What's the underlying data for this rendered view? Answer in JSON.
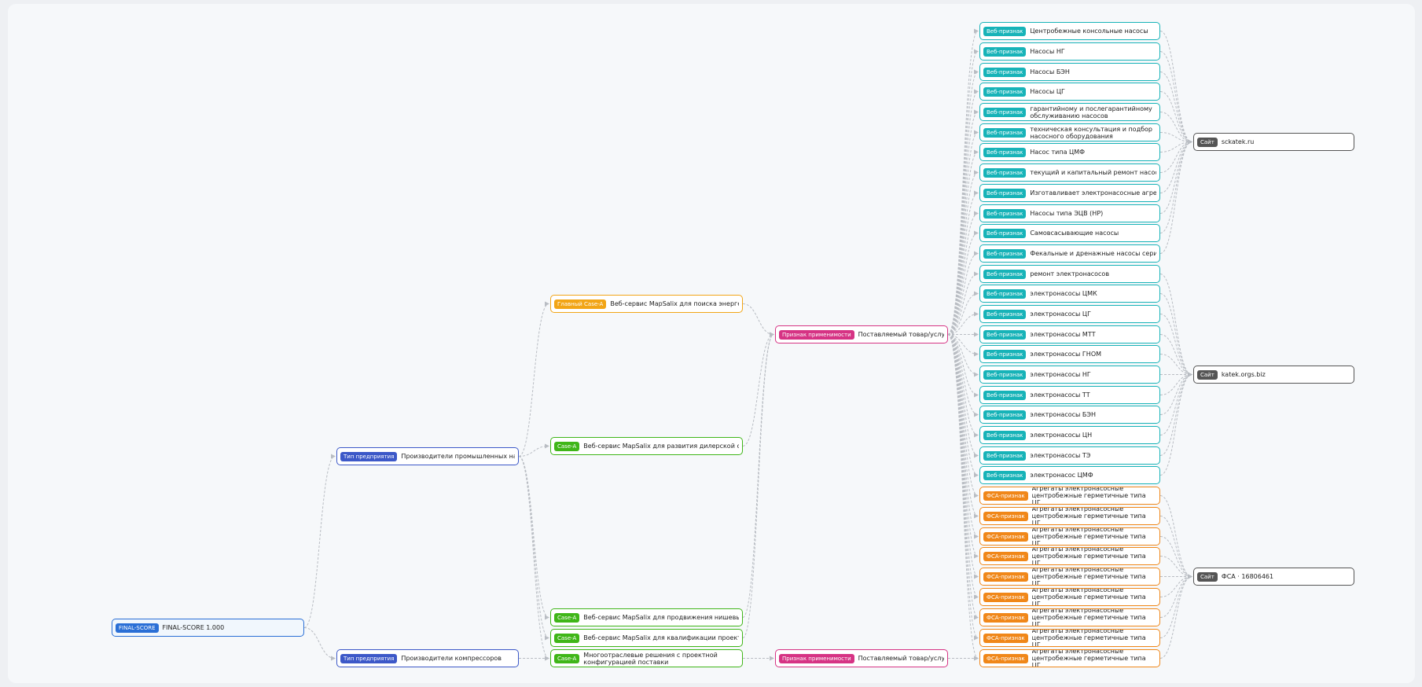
{
  "colors": {
    "final": "#2a6fd6",
    "type": "#3c58c8",
    "main_case": "#f2a516",
    "case": "#3fb618",
    "applicability": "#d63384",
    "web": "#17b3b8",
    "fsa": "#f08719",
    "site": "#555555",
    "edge": "#b9bdc3"
  },
  "nodes": {
    "final": {
      "tag": "FINAL-SCORE",
      "label": "FINAL-SCORE 1.000"
    },
    "type_pumps": {
      "tag": "Тип предприятия",
      "label": "Производители промышленных насосов"
    },
    "type_compressors": {
      "tag": "Тип предприятия",
      "label": "Производители компрессоров"
    },
    "case_main": {
      "tag": "Главный Case-A",
      "label": "Веб-сервис MapSalix для поиска энергетических"
    },
    "case_dealer": {
      "tag": "Case-A",
      "label": "Веб-сервис MapSalix для развития дилерской сети"
    },
    "case_niche": {
      "tag": "Case-A",
      "label": "Веб-сервис MapSalix для продвижения нишевых испол"
    },
    "case_qualify": {
      "tag": "Case-A",
      "label": "Веб-сервис MapSalix для квалификации проектных лид"
    },
    "case_multi": {
      "tag": "Case-A",
      "label": "Многоотраслевые решения с проектной конфигурацией поставки"
    },
    "appl_1": {
      "tag": "Признак применимости",
      "label": "Поставляемый товар/услуга"
    },
    "appl_2": {
      "tag": "Признак применимости",
      "label": "Поставляемый товар/услуга"
    },
    "web": [
      {
        "tag": "Веб-признак",
        "label": "Центробежные консольные насосы"
      },
      {
        "tag": "Веб-признак",
        "label": "Насосы НГ"
      },
      {
        "tag": "Веб-признак",
        "label": "Насосы БЭН"
      },
      {
        "tag": "Веб-признак",
        "label": "Насосы ЦГ"
      },
      {
        "tag": "Веб-признак",
        "label": "гарантийному и послегарантийному обслуживанию насосов"
      },
      {
        "tag": "Веб-признак",
        "label": "техническая консультация и подбор насосного оборудования"
      },
      {
        "tag": "Веб-признак",
        "label": "Насос типа ЦМФ"
      },
      {
        "tag": "Веб-признак",
        "label": "текущий и капитальный ремонт насосного обо"
      },
      {
        "tag": "Веб-признак",
        "label": "Изготавливает электронасосные агрегаты типа"
      },
      {
        "tag": "Веб-признак",
        "label": "Насосы типа ЭЦВ (НР)"
      },
      {
        "tag": "Веб-признак",
        "label": "Самовсасывающие насосы"
      },
      {
        "tag": "Веб-признак",
        "label": "Фекальные и дренажные насосы серии «Ирты"
      },
      {
        "tag": "Веб-признак",
        "label": "ремонт электронасосов"
      },
      {
        "tag": "Веб-признак",
        "label": "электронасосы ЦМК"
      },
      {
        "tag": "Веб-признак",
        "label": "электронасосы ЦГ"
      },
      {
        "tag": "Веб-признак",
        "label": "электронасосы МТТ"
      },
      {
        "tag": "Веб-признак",
        "label": "электронасосы ГНОМ"
      },
      {
        "tag": "Веб-признак",
        "label": "электронасосы НГ"
      },
      {
        "tag": "Веб-признак",
        "label": "электронасосы ТТ"
      },
      {
        "tag": "Веб-признак",
        "label": "электронасосы БЭН"
      },
      {
        "tag": "Веб-признак",
        "label": "электронасосы ЦН"
      },
      {
        "tag": "Веб-признак",
        "label": "электронасосы ТЭ"
      },
      {
        "tag": "Веб-признак",
        "label": "электронасос ЦМФ"
      }
    ],
    "fsa": [
      {
        "tag": "ФСА-признак",
        "label": "Агрегаты электронасосные центробежные герметичные типа ЦГ,"
      },
      {
        "tag": "ФСА-признак",
        "label": "Агрегаты электронасосные центробежные герметичные типа ЦГ,"
      },
      {
        "tag": "ФСА-признак",
        "label": "Агрегаты электронасосные центробежные герметичные типа ЦГ,"
      },
      {
        "tag": "ФСА-признак",
        "label": "Агрегаты электронасосные центробежные герметичные типа ЦГ,"
      },
      {
        "tag": "ФСА-признак",
        "label": "Агрегаты электронасосные центробежные герметичные типа ЦГ,"
      },
      {
        "tag": "ФСА-признак",
        "label": "Агрегаты электронасосные центробежные герметичные типа ЦГ,"
      },
      {
        "tag": "ФСА-признак",
        "label": "Агрегаты электронасосные центробежные герметичные типа ЦГ,"
      },
      {
        "tag": "ФСА-признак",
        "label": "Агрегаты электронасосные центробежные герметичные типа ЦГ,"
      },
      {
        "tag": "ФСА-признак",
        "label": "Агрегаты электронасосные центробежные герметичные типа ЦГ,"
      }
    ],
    "sites": [
      {
        "tag": "Сайт",
        "label": "sckatek.ru"
      },
      {
        "tag": "Сайт",
        "label": "katek.orgs.biz"
      },
      {
        "tag": "Сайт",
        "label": "ФСА · 16806461"
      }
    ]
  }
}
